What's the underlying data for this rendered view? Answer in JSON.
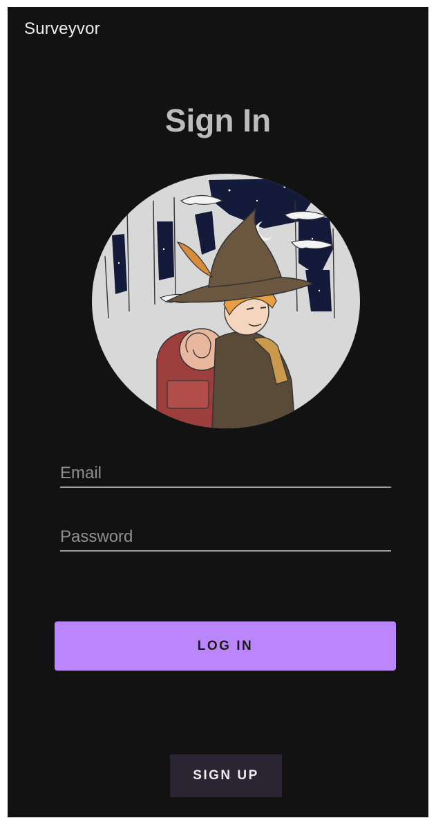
{
  "app_bar": {
    "title": "Surveyvor"
  },
  "page": {
    "title": "Sign In"
  },
  "avatar": {
    "icon": "traveler-illustration-avatar",
    "description_colors": {
      "background": "#d8d8d8",
      "night_sky": "#141a3a",
      "hat": "#6b5640",
      "backpack": "#9c3f3c",
      "hair": "#e8a040"
    }
  },
  "form": {
    "email": {
      "value": "",
      "placeholder": "Email"
    },
    "password": {
      "value": "",
      "placeholder": "Password"
    }
  },
  "buttons": {
    "login_label": "LOG IN",
    "signup_label": "SIGN UP"
  },
  "colors": {
    "background": "#121212",
    "primary": "#bb86fc",
    "secondary_button": "#2a2433",
    "title_text": "#bdbdbd"
  }
}
